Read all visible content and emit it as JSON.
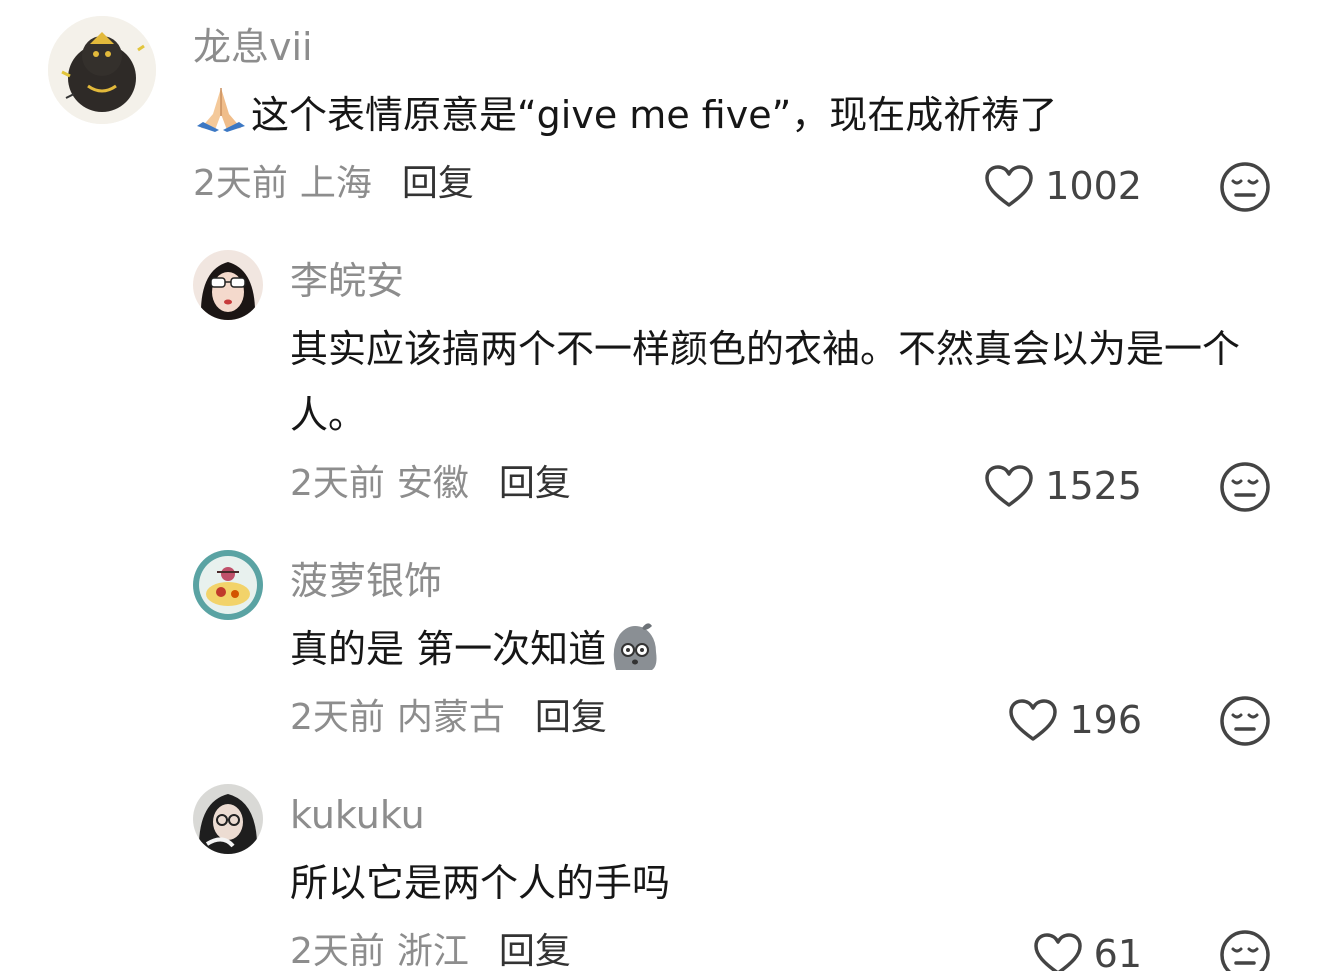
{
  "comments": [
    {
      "username": "龙息vii",
      "content_emoji": "folded-hands-emoji",
      "content": "这个表情原意是“give me five”，现在成祈祷了",
      "time": "2天前",
      "location": "上海",
      "reply_label": "回复",
      "likes": "1002"
    },
    {
      "username": "李皖安",
      "content": "其实应该搞两个不一样颜色的衣袖。不然真会以为是一个人。",
      "time": "2天前",
      "location": "安徽",
      "reply_label": "回复",
      "likes": "1525"
    },
    {
      "username": "菠萝银饰",
      "content": "真的是 第一次知道",
      "content_emoji": "surprised-ghost-sticker",
      "time": "2天前",
      "location": "内蒙古",
      "reply_label": "回复",
      "likes": "196"
    },
    {
      "username": "kukuku",
      "content": "所以它是两个人的手吗",
      "time": "2天前",
      "location": "浙江",
      "reply_label": "回复",
      "likes": "61"
    }
  ],
  "colors": {
    "username": "#8d8d8d",
    "content": "#161616",
    "meta": "#8d8d8d",
    "reply": "#333333",
    "icon_stroke": "#444444"
  },
  "icons": {
    "like": "heart-outline-icon",
    "dislike": "meh-face-icon"
  }
}
